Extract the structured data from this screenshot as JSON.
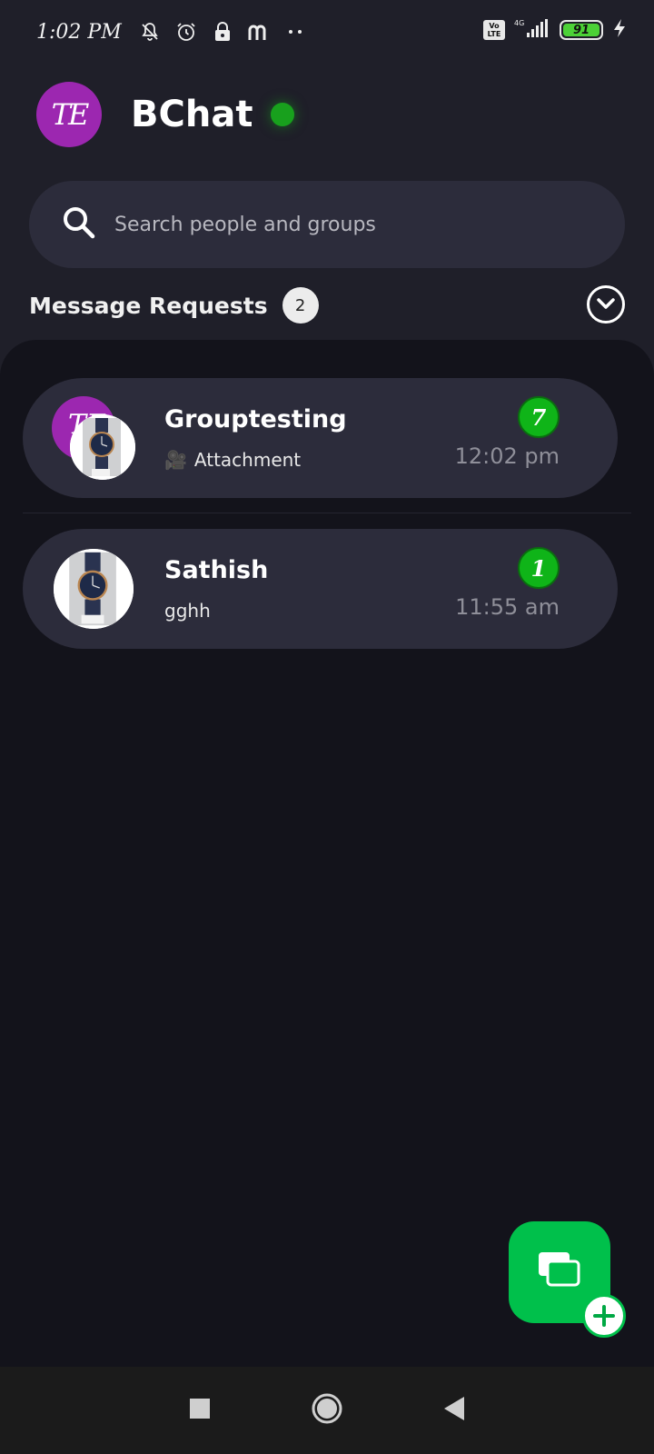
{
  "status_bar": {
    "time": "1:02 PM",
    "network": "4G",
    "battery_level": "91",
    "icons": [
      "mute-icon",
      "alarm-icon",
      "lock-icon",
      "m-app-icon",
      "more-dots-icon",
      "volte-icon",
      "signal-icon",
      "battery-icon",
      "charging-icon"
    ]
  },
  "header": {
    "avatar_initials": "TE",
    "title": "BChat",
    "online": true
  },
  "search": {
    "placeholder": "Search people and groups"
  },
  "message_requests": {
    "label": "Message Requests",
    "count": "2"
  },
  "chats": [
    {
      "name": "Grouptesting",
      "preview_icon": "🎥",
      "preview": "Attachment",
      "time": "12:02 pm",
      "unread": "7",
      "is_group": true,
      "group_initials": "TE"
    },
    {
      "name": "Sathish",
      "preview": "gghh",
      "time": "11:55 am",
      "unread": "1",
      "is_group": false
    }
  ],
  "colors": {
    "background": "#1f1f29",
    "panel": "#13131b",
    "card": "#2c2c3b",
    "accent_green": "#00c04b",
    "avatar_purple": "#9c27b0"
  }
}
